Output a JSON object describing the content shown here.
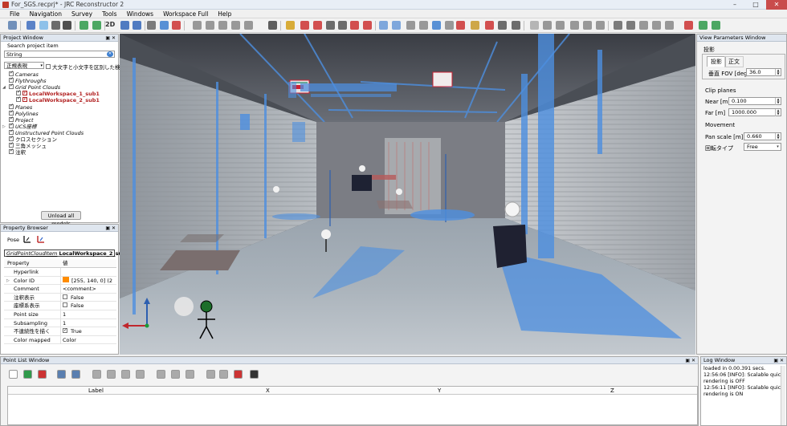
{
  "window": {
    "title": "For_SGS.recprj* - JRC Reconstructor 2",
    "controls": [
      "–",
      "□",
      "✕"
    ]
  },
  "menu": [
    "File",
    "Navigation",
    "Survey",
    "Tools",
    "Windows",
    "Workspace Full",
    "Help"
  ],
  "toolbar": {
    "view2d_label": "2D"
  },
  "project_window": {
    "title": "Project Window",
    "search_label": "Search project item",
    "search_value": "String",
    "mode_select": "正規表現",
    "case_label": "大文字と小文字を区別した検索",
    "tree": [
      {
        "label": "Cameras",
        "checked": true,
        "indent": 1,
        "style": "italic"
      },
      {
        "label": "Flythroughs",
        "checked": true,
        "indent": 1,
        "style": "italic"
      },
      {
        "label": "Grid Point Clouds",
        "checked": true,
        "indent": 1,
        "style": "italic",
        "expander": "◢"
      },
      {
        "label": "LocalWorkspace_1_sub1",
        "checked": true,
        "indent": 2,
        "style": "red"
      },
      {
        "label": "LocalWorkspace_2_sub1",
        "checked": true,
        "indent": 2,
        "style": "red"
      },
      {
        "label": "Planes",
        "checked": true,
        "indent": 1,
        "style": "italic"
      },
      {
        "label": "Polylines",
        "checked": true,
        "indent": 1,
        "style": "italic"
      },
      {
        "label": "Project",
        "checked": true,
        "indent": 1,
        "style": "italic"
      },
      {
        "label": "UCS座標",
        "checked": true,
        "indent": 1,
        "style": "italic",
        "expander": "▷"
      },
      {
        "label": "Unstructured Point Clouds",
        "checked": true,
        "indent": 1,
        "style": "italic"
      },
      {
        "label": "クロスセクション",
        "checked": true,
        "indent": 1,
        "style": "plain"
      },
      {
        "label": "三角メッシュ",
        "checked": true,
        "indent": 1,
        "style": "plain"
      },
      {
        "label": "注釈",
        "checked": true,
        "indent": 1,
        "style": "plain"
      }
    ],
    "unload_button": "Unload all models"
  },
  "property_browser": {
    "title": "Property Browser",
    "pose_label": "Pose",
    "item_type": "GridPointCloudItem",
    "item_name": "LocalWorkspace_2_sub1",
    "header_key": "Property",
    "header_val": "値",
    "rows": [
      {
        "key": "Hyperlink",
        "val": "",
        "type": "text"
      },
      {
        "key": "Color ID",
        "val": "[255, 140, 0] (2",
        "type": "color",
        "color": "#ff8c00",
        "expander": true
      },
      {
        "key": "Comment",
        "val": "<comment>",
        "type": "text"
      },
      {
        "key": "注釈表示",
        "val": "False",
        "type": "check",
        "checked": false
      },
      {
        "key": "座標系表示",
        "val": "False",
        "type": "check",
        "checked": false
      },
      {
        "key": "Point size",
        "val": "1",
        "type": "text"
      },
      {
        "key": "Subsampling",
        "val": "1",
        "type": "text"
      },
      {
        "key": "不連続性を描く",
        "val": "True",
        "type": "check",
        "checked": true
      },
      {
        "key": "Color mapped",
        "val": "Color",
        "type": "text"
      }
    ]
  },
  "view_params": {
    "title": "View Parameters Window",
    "projection_label": "投影",
    "tabs": [
      "投影",
      "正文"
    ],
    "fov_label": "垂直 FOV [deg]",
    "fov_value": "36.0",
    "clip_label": "Clip planes",
    "near_label": "Near [m]",
    "near_value": "0.100",
    "far_label": "Far [m]",
    "far_value": "1000.000",
    "movement_label": "Movement",
    "pan_label": "Pan scale [m]",
    "pan_value": "0.660",
    "rotate_label": "回転タイプ",
    "rotate_value": "Free"
  },
  "point_list": {
    "title": "Point List Window",
    "columns": [
      "Label",
      "X",
      "Y",
      "Z"
    ]
  },
  "log_window": {
    "title": "Log Window",
    "lines": [
      "loaded in 0.00.391 secs.",
      "12:56:06 [INFO]: Scalable quick",
      "rendering is OFF",
      "12:56:11 [INFO]: Scalable quick",
      "rendering is ON"
    ]
  },
  "colors": {
    "accent": "#3d7fd0",
    "point_blue": "#4d8fe0",
    "highlight_red": "#b22222"
  }
}
